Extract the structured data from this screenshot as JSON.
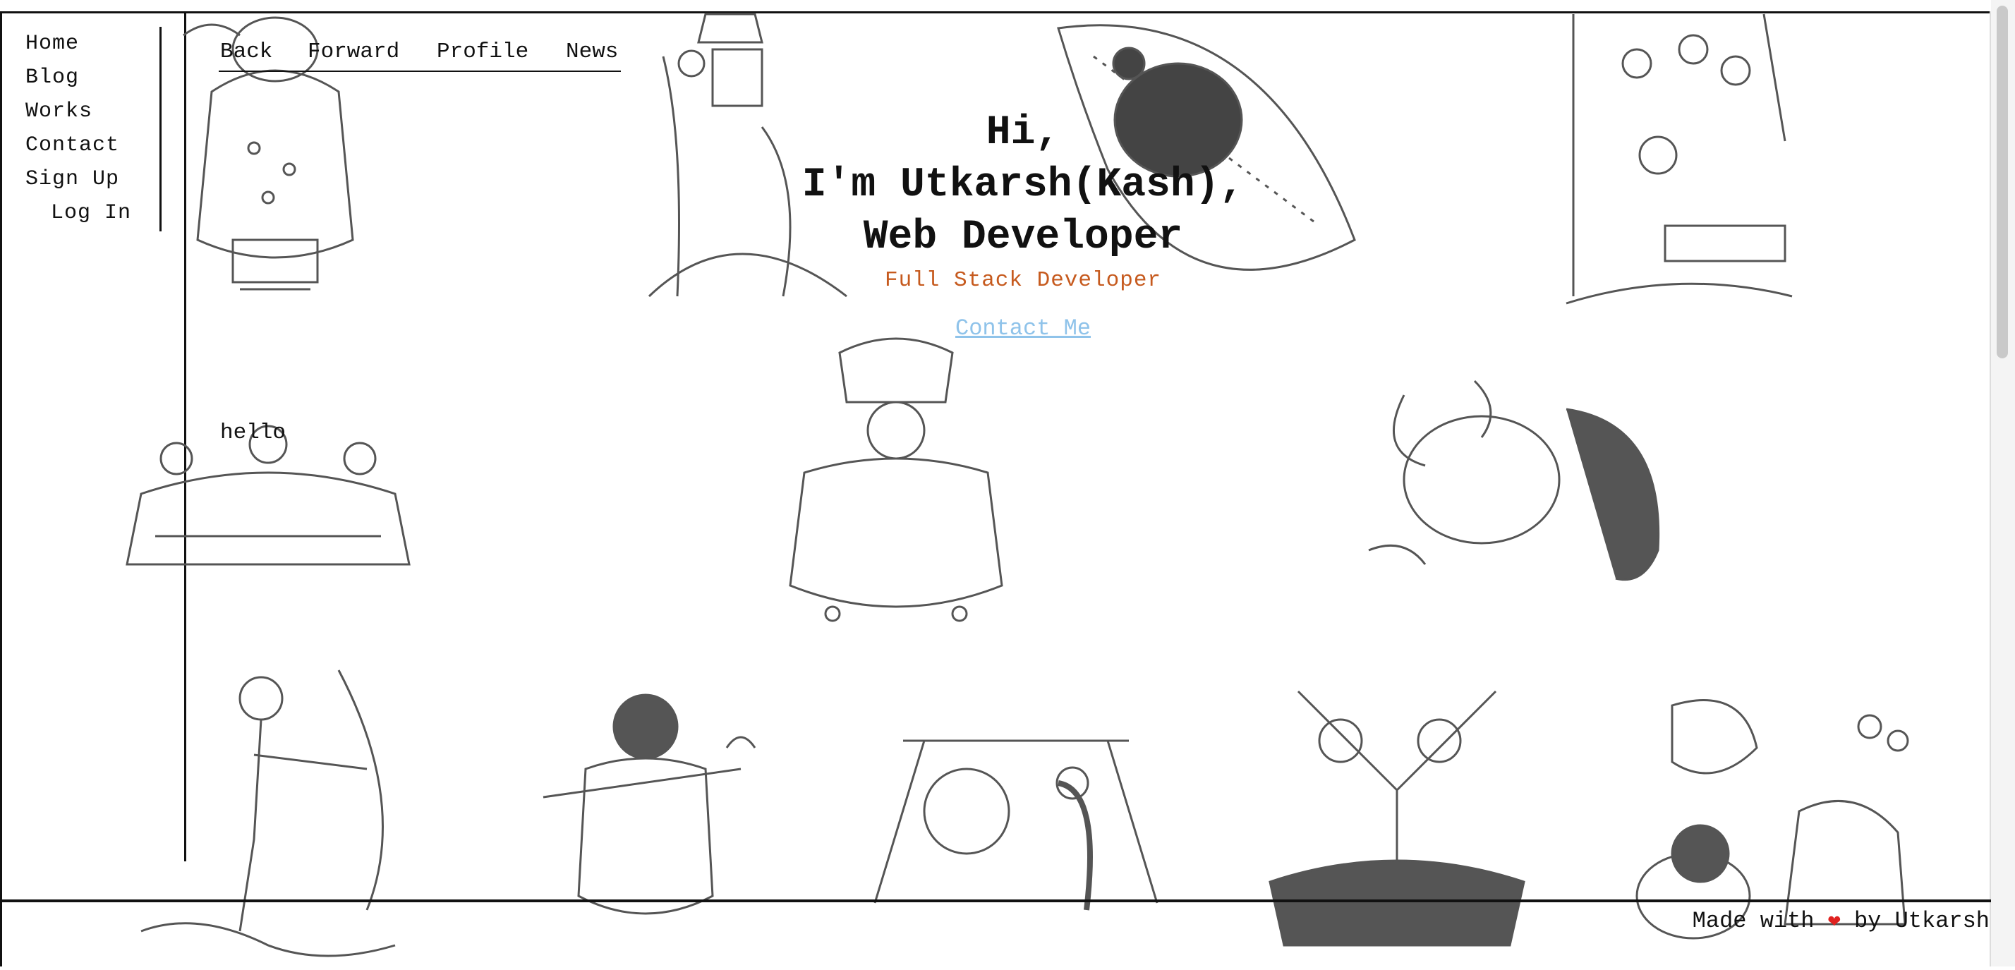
{
  "sidebar": {
    "items": [
      {
        "label": "Home"
      },
      {
        "label": "Blog"
      },
      {
        "label": "Works"
      },
      {
        "label": "Contact"
      },
      {
        "label": "Sign Up"
      },
      {
        "label": "Log In"
      }
    ]
  },
  "topnav": {
    "items": [
      {
        "label": "Back"
      },
      {
        "label": "Forward"
      },
      {
        "label": "Profile"
      },
      {
        "label": "News"
      }
    ]
  },
  "hero": {
    "line1": "Hi,",
    "line2": "I'm Utkarsh(Kash),",
    "line3": "Web Developer",
    "subtitle": "Full Stack Developer",
    "contact_link": "Contact Me"
  },
  "hello_text": "hello",
  "footer": {
    "prefix": "Made with",
    "suffix": "by Utkarsh",
    "heart_icon": "heart-icon"
  },
  "colors": {
    "subtitle": "#c65a1e",
    "link": "#8fc3ea",
    "heart": "#e0211f",
    "art_stroke": "#555555"
  }
}
